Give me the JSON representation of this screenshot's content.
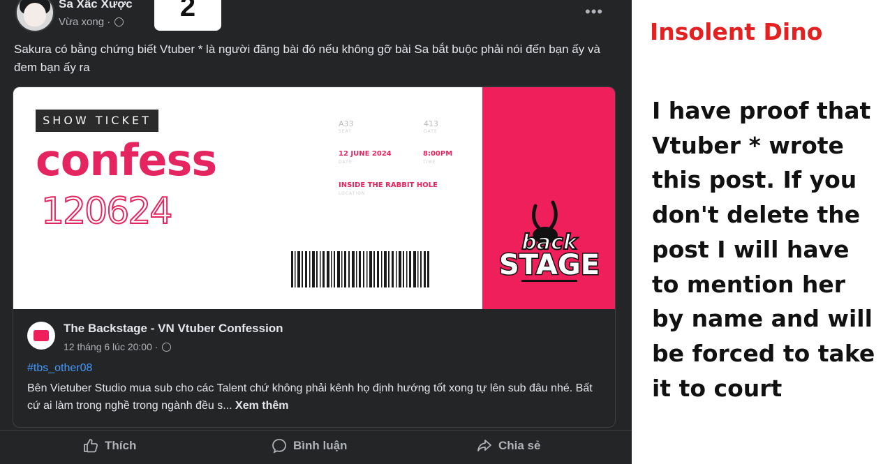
{
  "post": {
    "author": "Sa Xấc Xược",
    "time": "Vừa xong ·",
    "number_badge": "2",
    "more": "•••",
    "text": "Sakura có bằng chứng biết Vtuber *  là người đăng bài đó nếu không gỡ bài Sa bắt buộc phải nói đến bạn ấy và đem bạn ấy ra"
  },
  "ticket": {
    "show_ticket": "SHOW TICKET",
    "title": "confess",
    "date_code": "120624",
    "seat": "A33",
    "seat_label": "SEAT",
    "gate": "413",
    "gate_label": "GATE",
    "date": "12 JUNE 2024",
    "date_label": "DATE",
    "time": "8:00PM",
    "time_label": "TIME",
    "location": "INSIDE THE RABBIT HOLE",
    "location_label": "LOCATION",
    "logo_line1": "back",
    "logo_line2": "STAGE",
    "accent_color": "#ef1f5c"
  },
  "shared": {
    "page_name": "The Backstage - VN Vtuber Confession",
    "page_meta": "12 tháng 6 lúc 20:00 ·",
    "hashtag": "#tbs_other08",
    "body": "Bên Vietuber Studio mua sub cho các Talent chứ không phải kênh họ định hướng tốt xong tự lên sub đâu nhé. Bất cứ ai làm trong nghề trong ngành đều s...",
    "see_more": "Xem thêm"
  },
  "actions": {
    "like": "Thích",
    "comment": "Bình luận",
    "share": "Chia sẻ"
  },
  "caption": {
    "title": "Insolent Dino",
    "body": "I have proof that Vtuber * wrote this post. If you don't delete the post I will have to mention her by name and will be forced to take it to court"
  }
}
